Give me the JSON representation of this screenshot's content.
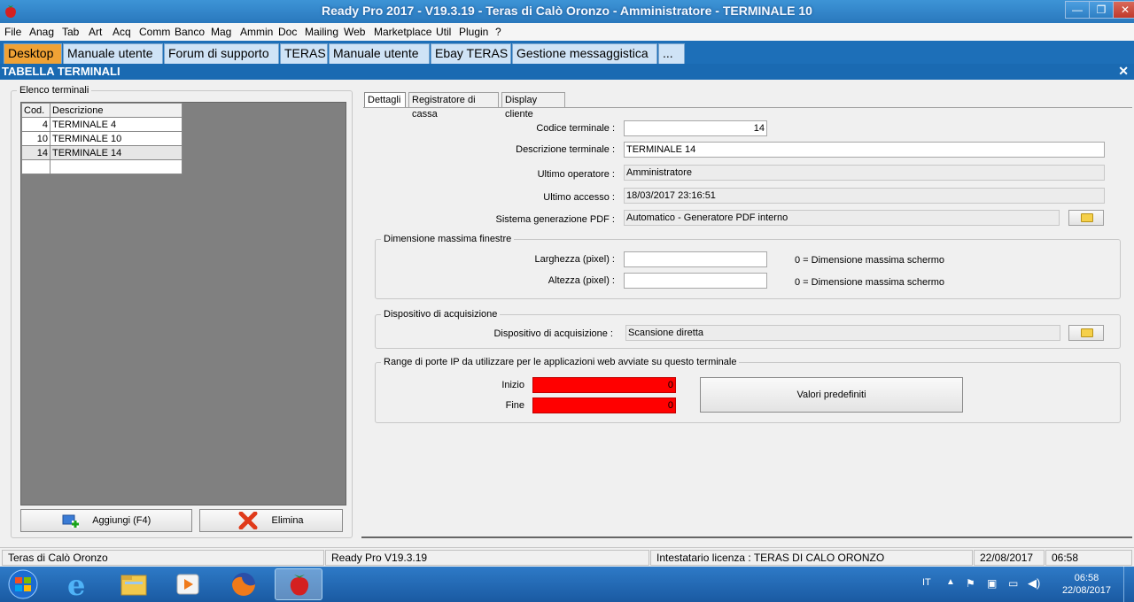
{
  "window": {
    "title": "Ready Pro 2017 - V19.3.19 - Teras di Calò Oronzo - Amministratore - TERMINALE 10"
  },
  "menu": [
    "File",
    "Anag",
    "Tab",
    "Art",
    "Acq",
    "Comm",
    "Banco",
    "Mag",
    "Ammin",
    "Doc",
    "Mailing",
    "Web",
    "Marketplace",
    "Util",
    "Plugin",
    "?"
  ],
  "app_tabs": [
    "Desktop",
    "Manuale utente",
    "Forum di supporto",
    "TERAS",
    "Manuale utente",
    "Ebay TERAS",
    "Gestione messaggistica",
    "..."
  ],
  "panel": {
    "title": "TABELLA TERMINALI"
  },
  "list_group": {
    "label": "Elenco terminali",
    "columns": [
      "Cod.",
      "Descrizione"
    ],
    "rows": [
      {
        "code": "4",
        "desc": "TERMINALE 4"
      },
      {
        "code": "10",
        "desc": "TERMINALE 10"
      },
      {
        "code": "14",
        "desc": "TERMINALE 14"
      }
    ],
    "add_label": "Aggiungi (F4)",
    "delete_label": "Elimina"
  },
  "subtabs": [
    "Dettagli",
    "Registratore di cassa",
    "Display cliente"
  ],
  "details": {
    "codice_label": "Codice terminale :",
    "codice": "14",
    "descrizione_label": "Descrizione terminale :",
    "descrizione": "TERMINALE 14",
    "operatore_label": "Ultimo operatore :",
    "operatore": "Amministratore",
    "accesso_label": "Ultimo accesso :",
    "accesso": "18/03/2017  23:16:51",
    "pdf_label": "Sistema generazione PDF :",
    "pdf": "Automatico - Generatore PDF interno"
  },
  "dimensioni": {
    "label": "Dimensione massima finestre",
    "larghezza_label": "Larghezza (pixel) :",
    "larghezza": "",
    "altezza_label": "Altezza (pixel) :",
    "altezza": "",
    "note": "0 =   Dimensione massima schermo"
  },
  "acquisizione": {
    "group_label": "Dispositivo di acquisizione",
    "label": "Dispositivo di acquisizione :",
    "value": "Scansione diretta"
  },
  "porte": {
    "label": "Range di porte IP da utilizzare per le applicazioni web avviate su questo terminale",
    "inizio_label": "Inizio",
    "inizio": "0",
    "fine_label": "Fine",
    "fine": "0",
    "defaults_label": "Valori predefiniti"
  },
  "status": {
    "company": "Teras di Calò Oronzo",
    "version": "Ready Pro V19.3.19",
    "license": "Intestatario licenza : TERAS DI CALO ORONZO",
    "date": "22/08/2017",
    "time": "06:58"
  },
  "taskbar": {
    "lang": "IT",
    "clock_time": "06:58",
    "clock_date": "22/08/2017"
  },
  "colors": {
    "title_bar": "#2a78bd",
    "tab_bar": "#1d6fb8",
    "active_tab": "#f0a235",
    "port_field": "#ff0000"
  }
}
